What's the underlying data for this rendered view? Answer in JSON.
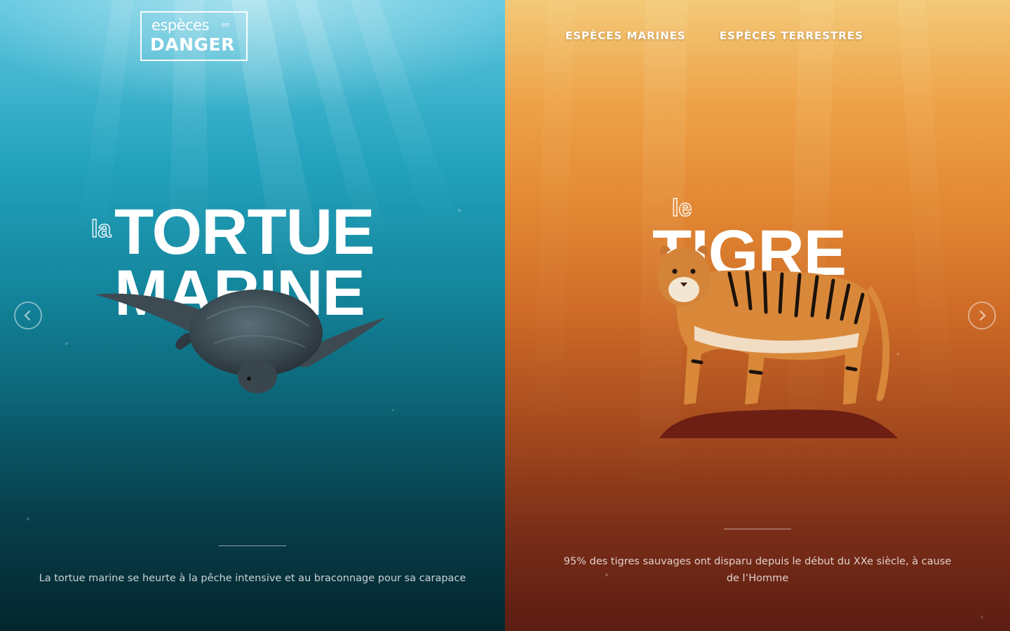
{
  "brand": {
    "logo_top": "espèces",
    "logo_en": "en",
    "logo_bottom": "DANGER"
  },
  "nav": {
    "items": [
      {
        "label": "ESPÈCES MARINES"
      },
      {
        "label": "ESPÈCES TERRESTRES"
      }
    ]
  },
  "left_panel": {
    "article": "la",
    "title_line1": "TORTUE",
    "title_line2": "MARINE",
    "description": "La tortue marine se heurte à la pêche intensive et au braconnage pour sa carapace",
    "animal_icon": "sea-turtle-icon",
    "colors": {
      "top": "#5fc7e0",
      "bottom": "#04262e"
    }
  },
  "right_panel": {
    "article": "le",
    "title": "TIGRE",
    "description": "95% des tigres sauvages ont disparu depuis le début du XXe siècle, à cause de l’Homme",
    "animal_icon": "tiger-icon",
    "colors": {
      "top": "#f3c978",
      "bottom": "#5c1d13"
    }
  },
  "controls": {
    "prev_icon": "chevron-left-icon",
    "next_icon": "chevron-right-icon"
  }
}
